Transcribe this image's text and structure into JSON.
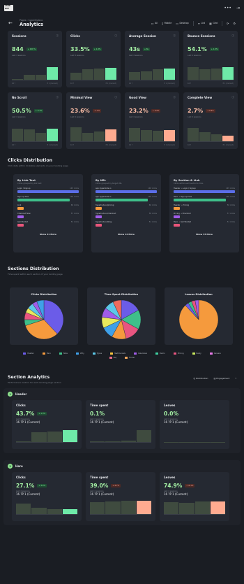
{
  "topbar": {
    "logo": "LAND GUY",
    "icons": [
      "•••",
      "⇥"
    ]
  },
  "header": {
    "breadcrumb": "Pages › hyperlinds.io",
    "title": "Analytics",
    "buttons": [
      {
        "label": "All",
        "icon": "▭"
      },
      {
        "label": "Mobile",
        "icon": "▯"
      },
      {
        "label": "Desktop",
        "icon": "▭"
      },
      {
        "label": "List",
        "icon": "≡"
      },
      {
        "label": "Grid",
        "icon": "▦"
      }
    ]
  },
  "metrics": [
    {
      "label": "Sessions",
      "value": "844",
      "badge": "+ 100 %",
      "badge_type": "up",
      "sub": "Last 4 sessions",
      "bars": [
        0.05,
        0.3,
        0.33,
        0.8
      ],
      "accent": "g",
      "foot_left": "16 ?",
      "foot_right": "P 1 (Current)"
    },
    {
      "label": "Clicks",
      "value": "33.5%",
      "badge": "+ 1.3%",
      "badge_type": "up",
      "sub": "Last 4 sessions",
      "bars": [
        0.45,
        0.7,
        0.75,
        0.78
      ],
      "accent": "g",
      "foot_left": "16 ?",
      "foot_right": "P 1 (Current)"
    },
    {
      "label": "Average Session",
      "value": "43s",
      "badge": "+ 8s",
      "badge_type": "up",
      "sub": "Last 4 sessions",
      "bars": [
        0.5,
        0.55,
        0.7,
        0.75
      ],
      "accent": "g",
      "foot_left": "16 ?",
      "foot_right": "P 1 (Current)"
    },
    {
      "label": "Bounce Sessions",
      "value": "54.1%",
      "badge": "+ 1.3%",
      "badge_type": "up",
      "sub": "Last 4 sessions",
      "bars": [
        0.8,
        0.7,
        0.72,
        0.8
      ],
      "accent": "g",
      "foot_left": "16 ?",
      "foot_right": "P 1 (Current)"
    },
    {
      "label": "No Scroll",
      "value": "50.5%",
      "badge": "+ 0.7%",
      "badge_type": "up",
      "sub": "Last 4 sessions",
      "bars": [
        0.82,
        0.78,
        0.55,
        0.8
      ],
      "accent": "g",
      "foot_left": "16 ?",
      "foot_right": "P 1 (Current)"
    },
    {
      "label": "Minimal View",
      "value": "23.6%",
      "badge": "- 1.1%",
      "badge_type": "down",
      "sub": "Last 4 sessions",
      "bars": [
        0.9,
        0.55,
        0.65,
        0.78
      ],
      "accent": "p",
      "foot_left": "16 ?",
      "foot_right": "P 1 (Current)"
    },
    {
      "label": "Good View",
      "value": "23.2%",
      "badge": "+ 0.2%",
      "badge_type": "down",
      "sub": "Last 4 sessions",
      "bars": [
        0.85,
        0.75,
        0.7,
        0.75
      ],
      "accent": "p",
      "foot_left": "16 ?",
      "foot_right": "P 1 (Current)"
    },
    {
      "label": "Complete View",
      "value": "2.7%",
      "badge": "+ 0.2%",
      "badge_type": "down",
      "sub": "Last 4 sessions",
      "bars": [
        0.85,
        0.6,
        0.45,
        0.35
      ],
      "accent": "p",
      "foot_left": "16 ?",
      "foot_right": "P 1 (Current)"
    }
  ],
  "clicks_distribution": {
    "title": "Clicks Distribution",
    "subtitle": "Click data within clickable elements on your landing page",
    "cards": [
      {
        "title": "By Link Text",
        "subtitle": "Clicks grouped by link text",
        "rows": [
          {
            "label": "Login / Signup",
            "value": "145 clicks",
            "color": "#5b6ee8",
            "pct": 1.0
          },
          {
            "label": "Sign up Free",
            "value": "126 clicks",
            "color": "#3fbf8a",
            "pct": 0.85
          },
          {
            "label": "Link",
            "value": "60 clicks",
            "color": "#f59a3d",
            "pct": 0.1
          },
          {
            "label": "Checkout Now",
            "value": "57 clicks",
            "color": "#a05ce8",
            "pct": 0.08
          },
          {
            "label": "Get Started",
            "value": "51 clicks",
            "color": "#e8557a",
            "pct": 0.06
          }
        ],
        "show_more": "Show 21 More"
      },
      {
        "title": "By URL",
        "subtitle": "Clicks grouped by target URL",
        "rows": [
          {
            "label": "app.hyperlinds.io",
            "value": "148 clicks",
            "color": "#5b6ee8",
            "pct": 1.0
          },
          {
            "label": "app.hyperlinds.io",
            "value": "126 clicks",
            "color": "#3fbf8a",
            "pct": 0.85
          },
          {
            "label": "hyperlinds.io/pricing",
            "value": "60 clicks",
            "color": "#f59a3d",
            "pct": 0.1
          },
          {
            "label": "hyperlinds.io/checkout",
            "value": "58 clicks",
            "color": "#a05ce8",
            "pct": 0.08
          },
          {
            "label": "hyperlinds.io/blog",
            "value": "51 clicks",
            "color": "#e8557a",
            "pct": 0.06
          }
        ],
        "show_more": "Show 14 More"
      },
      {
        "title": "By Section & Link",
        "subtitle": "Clicks within each section's links",
        "rows": [
          {
            "label": "Header → Login / Signup",
            "value": "145 clicks",
            "color": "#5b6ee8",
            "pct": 1.0
          },
          {
            "label": "Hero → Sign up Free",
            "value": "126 clicks",
            "color": "#3fbf8a",
            "pct": 0.85
          },
          {
            "label": "Header → Pricing",
            "value": "50 clicks",
            "color": "#f59a3d",
            "pct": 0.1
          },
          {
            "label": "Pricing → Checkout",
            "value": "57 clicks",
            "color": "#a05ce8",
            "pct": 0.08
          },
          {
            "label": "Hero → Get Started",
            "value": "51 clicks",
            "color": "#e8557a",
            "pct": 0.06
          }
        ],
        "show_more": "Show 33 More"
      }
    ]
  },
  "sections_distribution": {
    "title": "Sections Distribution",
    "subtitle": "Time spent within each section of your landing page",
    "pies": [
      {
        "title": "Clicks Distribution",
        "slices": [
          [
            0.38,
            "#6b5ce8"
          ],
          [
            0.32,
            "#f59a3d"
          ],
          [
            0.05,
            "#3fbf8a"
          ],
          [
            0.06,
            "#e85580"
          ],
          [
            0.04,
            "#e8e85c"
          ],
          [
            0.05,
            "#5cc8e8"
          ],
          [
            0.04,
            "#a05ce8"
          ],
          [
            0.06,
            "#3fa0e8"
          ]
        ]
      },
      {
        "title": "Time Spent Distribution",
        "slices": [
          [
            0.17,
            "#6b5ce8"
          ],
          [
            0.16,
            "#3fbf8a"
          ],
          [
            0.13,
            "#e85580"
          ],
          [
            0.12,
            "#f59a3d"
          ],
          [
            0.1,
            "#3fa0e8"
          ],
          [
            0.09,
            "#e8e85c"
          ],
          [
            0.08,
            "#a05ce8"
          ],
          [
            0.08,
            "#5cc8e8"
          ],
          [
            0.07,
            "#f06c5c"
          ]
        ]
      },
      {
        "title": "Leaves Distribution",
        "slices": [
          [
            0.88,
            "#f59a3d"
          ],
          [
            0.03,
            "#6b5ce8"
          ],
          [
            0.03,
            "#3fbf8a"
          ],
          [
            0.03,
            "#e85580"
          ],
          [
            0.03,
            "#a05ce8"
          ]
        ]
      }
    ],
    "legend": [
      {
        "label": "Header",
        "color": "#6b5ce8"
      },
      {
        "label": "Hero",
        "color": "#f59a3d"
      },
      {
        "label": "Note",
        "color": "#3fbf8a"
      },
      {
        "label": "Why",
        "color": "#3fa0e8"
      },
      {
        "label": "Types",
        "color": "#5cc8e8"
      },
      {
        "label": "Testimonials",
        "color": "#f5c23d"
      },
      {
        "label": "Calendars",
        "color": "#a05ce8"
      },
      {
        "label": "Demo",
        "color": "#3fd0a0"
      },
      {
        "label": "Pricing",
        "color": "#e85580"
      },
      {
        "label": "Reply",
        "color": "#c8e85c"
      },
      {
        "label": "Careers",
        "color": "#e87ae8"
      },
      {
        "label": "Faq",
        "color": "#f06c8c"
      },
      {
        "label": "Footer",
        "color": "#f5a85c"
      }
    ]
  },
  "section_analytics": {
    "title": "Section Analytics",
    "subtitle": "Performance metrics for each landing page section",
    "tools": {
      "distribution": "Distribution",
      "engagement": "Engagement",
      "help": "?"
    },
    "sections": [
      {
        "num": "1",
        "name": "Header",
        "cards": [
          {
            "label": "Clicks",
            "value": "43.7%",
            "badge": "+ 1.3%",
            "sub": "Last 4 sessions",
            "bars": [
              0.05,
              0.7,
              0.75,
              0.85
            ],
            "accent": "g",
            "foot_left": "16 ?",
            "foot_right": "P 1 (Current)"
          },
          {
            "label": "Time spent",
            "value": "0.1%",
            "badge": "",
            "sub": "Last 4 sessions",
            "bars": [
              0.05,
              0.05,
              0.1,
              0.85
            ],
            "accent": "n",
            "foot_left": "16 ?",
            "foot_right": "P 1 (Current)"
          },
          {
            "label": "Leaves",
            "value": "0.0%",
            "badge": "",
            "sub": "Last 4 sessions",
            "bars": [
              0.02,
              0.02,
              0.02,
              0.02
            ],
            "accent": "n",
            "foot_left": "16 ?",
            "foot_right": "P 1 (Current)"
          }
        ]
      },
      {
        "num": "2",
        "name": "Hero",
        "cards": [
          {
            "label": "Clicks",
            "value": "27.1%",
            "badge": "+ 3.4%",
            "sub": "Last 4 sessions",
            "bars": [
              0.75,
              0.45,
              0.35,
              0.35
            ],
            "accent": "g",
            "foot_left": "16 ?",
            "foot_right": "P 1 (Current)"
          },
          {
            "label": "Time spent",
            "value": "39.0%",
            "badge": "+ 4.7%",
            "sub": "Last 4 sessions",
            "bars": [
              0.85,
              0.9,
              0.95,
              0.95
            ],
            "accent": "p",
            "foot_left": "16 ?",
            "foot_right": "P 1 (Current)"
          },
          {
            "label": "Leaves",
            "value": "74.9%",
            "badge": "- 11.1%",
            "sub": "Last 4 sessions",
            "bars": [
              0.85,
              0.8,
              0.9,
              0.9
            ],
            "accent": "p",
            "foot_left": "16 ?",
            "foot_right": "P 1 (Current)"
          }
        ]
      }
    ]
  }
}
